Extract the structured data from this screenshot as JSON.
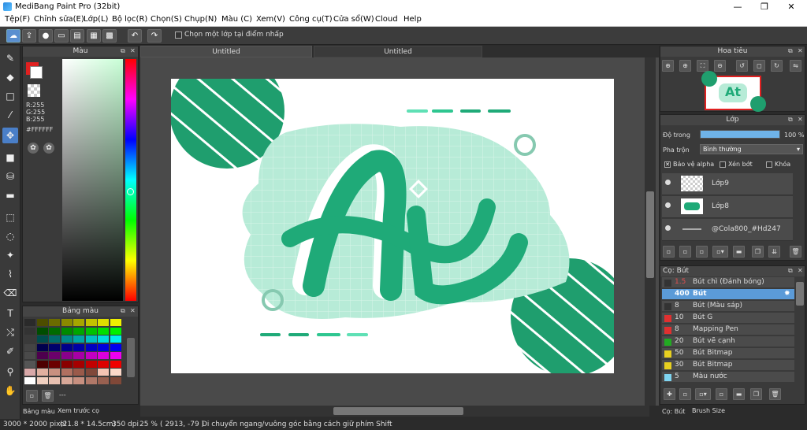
{
  "app": {
    "title": "MediBang Paint Pro (32bit)"
  },
  "menu": [
    "Tệp(F)",
    "Chỉnh sửa(E)",
    "Lớp(L)",
    "Bộ lọc(R)",
    "Chọn(S)",
    "Chụp(N)",
    "Màu (C)",
    "Xem(V)",
    "Công cụ(T)",
    "Cửa sổ(W)",
    "Cloud",
    "Help"
  ],
  "toolbar": {
    "snap_label": "Chọn một lớp tại điểm nhấp"
  },
  "color_panel": {
    "title": "Màu",
    "r": "R:255",
    "g": "G:255",
    "b": "B:255",
    "hex": "#FFFFFF"
  },
  "palette_panel": {
    "title": "Bảng màu",
    "name": "---"
  },
  "bottom_tabs": {
    "palette": "Bảng màu",
    "preview": "Xem trước cọ"
  },
  "canvas": {
    "tab_active": "Untitled",
    "tab_other": "Untitled"
  },
  "navigator": {
    "title": "Hoa tiêu"
  },
  "layers_panel": {
    "title": "Lớp",
    "opacity_label": "Độ trong",
    "opacity_value": "100 %",
    "opacity": 1.0,
    "blend_label": "Pha trộn",
    "blend_value": "Bình thường",
    "protect_alpha": "Bảo vệ alpha",
    "clipping": "Xén bớt",
    "lock": "Khóa",
    "layers": [
      {
        "name": "Lớp9"
      },
      {
        "name": "Lớp8"
      },
      {
        "name": "@Cola800_#Hd247"
      }
    ]
  },
  "brush_panel": {
    "title": "Cọ: Bút",
    "tab_brush": "Cọ: Bút",
    "tab_size": "Brush Size",
    "brushes": [
      {
        "size": "1.5",
        "name": "Bút chì (Đánh bóng)",
        "color": "#333333"
      },
      {
        "size": "400",
        "name": "Bút",
        "color": "#5b9bd8",
        "selected": true
      },
      {
        "size": "8",
        "name": "Bút (Màu sáp)",
        "color": "#333333"
      },
      {
        "size": "10",
        "name": "Bút G",
        "color": "#e03030"
      },
      {
        "size": "8",
        "name": "Mapping Pen",
        "color": "#e03030"
      },
      {
        "size": "20",
        "name": "Bút vẽ cạnh",
        "color": "#22aa22"
      },
      {
        "size": "50",
        "name": "Bút Bitmap",
        "color": "#e8d020"
      },
      {
        "size": "30",
        "name": "Bút Bitmap",
        "color": "#e8d020"
      },
      {
        "size": "5",
        "name": "Màu nước",
        "color": "#7fd4f0"
      }
    ]
  },
  "status": {
    "size": "3000 * 2000 pixel",
    "cm": "(21.8 * 14.5cm)",
    "dpi": "350 dpi",
    "zoom": "25 %",
    "coords": "( 2913, -79 )",
    "hint": "Di chuyển ngang/vuông góc bằng cách giữ phím Shift"
  },
  "colors": {
    "accent": "#1faa78",
    "light": "#a8e6cf",
    "select": "#5b9bd8"
  }
}
